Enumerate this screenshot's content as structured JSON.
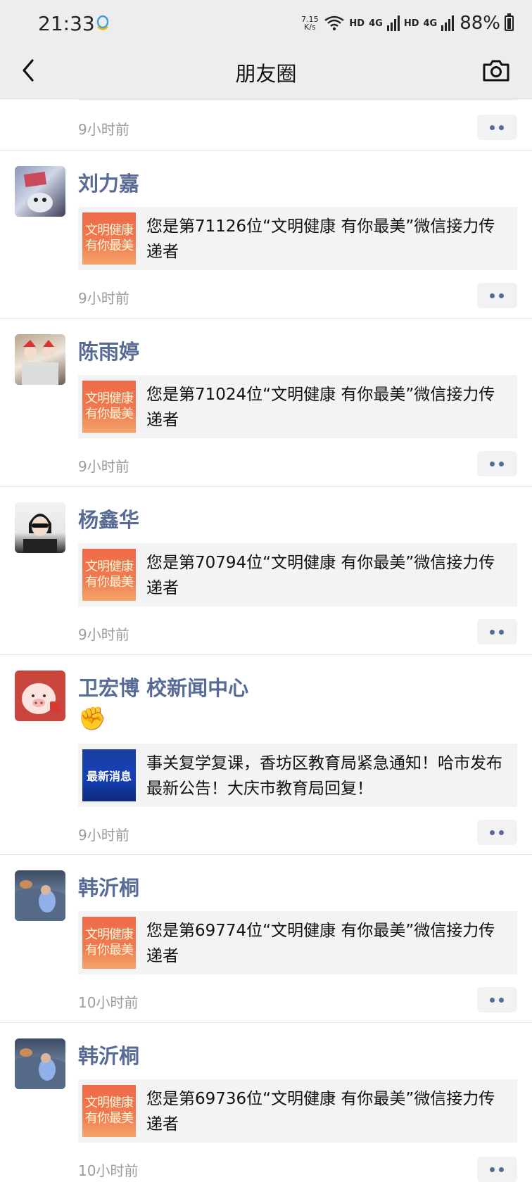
{
  "status": {
    "time": "21:33",
    "net_speed_top": "7.15",
    "net_speed_bottom": "K/s",
    "hd1": "HD",
    "sig1": "4G",
    "hd2": "HD",
    "sig2": "4G",
    "battery": "88%"
  },
  "nav": {
    "title": "朋友圈",
    "back_icon": "chevron-left-icon",
    "camera_icon": "camera-icon"
  },
  "top_partial": {
    "time": "9小时前"
  },
  "posts": [
    {
      "name": "刘力嘉",
      "card_text": "您是第71126位“文明健康 有你最美”微信接力传递者",
      "thumb_line1": "文明健康",
      "thumb_line2": "有你最美",
      "time": "9小时前"
    },
    {
      "name": "陈雨婷",
      "card_text": "您是第71024位“文明健康 有你最美”微信接力传递者",
      "thumb_line1": "文明健康",
      "thumb_line2": "有你最美",
      "time": "9小时前"
    },
    {
      "name": "杨鑫华",
      "card_text": "您是第70794位“文明健康 有你最美”微信接力传递者",
      "thumb_line1": "文明健康",
      "thumb_line2": "有你最美",
      "time": "9小时前"
    },
    {
      "name": "卫宏博 校新闻中心",
      "emoji": "✊",
      "card_text": "事关复学复课，香坊区教育局紧急通知！哈市发布最新公告！大庆市教育局回复！",
      "thumb_label": "最新消息",
      "time": "9小时前"
    },
    {
      "name": "韩沂桐",
      "card_text": "您是第69774位“文明健康 有你最美”微信接力传递者",
      "thumb_line1": "文明健康",
      "thumb_line2": "有你最美",
      "time": "10小时前"
    },
    {
      "name": "韩沂桐",
      "card_text": "您是第69736位“文明健康 有你最美”微信接力传递者",
      "thumb_line1": "文明健康",
      "thumb_line2": "有你最美",
      "time": "10小时前"
    }
  ],
  "colors": {
    "link_blue": "#576b95",
    "bar_bg": "#ededed",
    "card_bg": "#f3f3f3",
    "time_gray": "#9b9b9b"
  }
}
